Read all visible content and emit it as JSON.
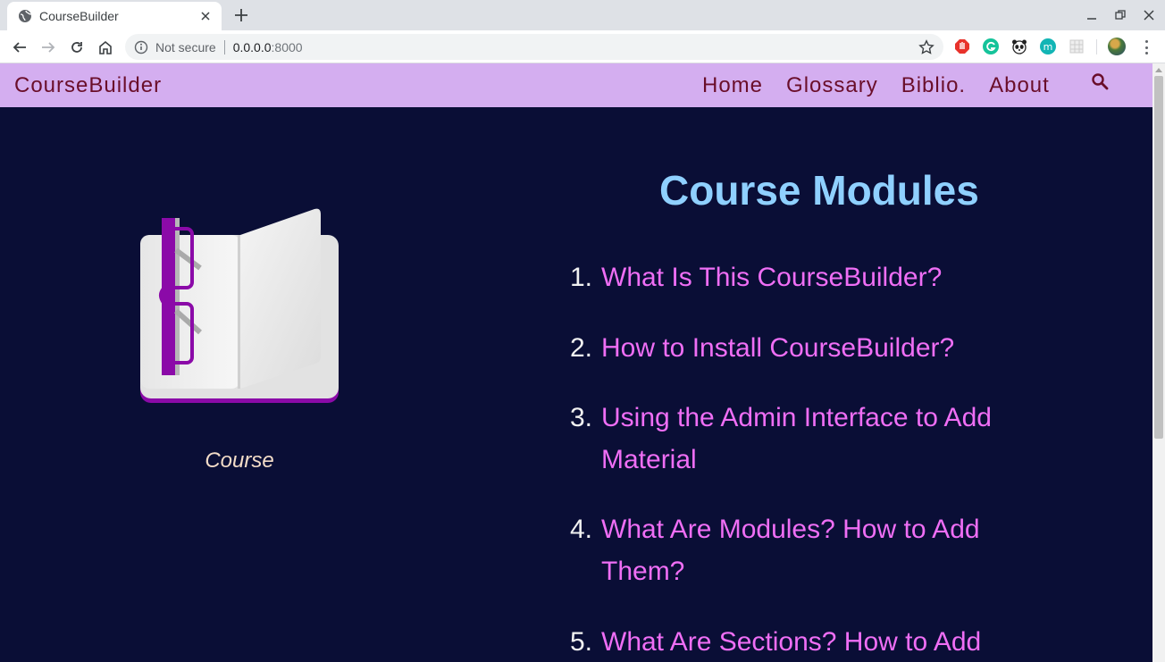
{
  "browser": {
    "tab_title": "CourseBuilder",
    "security_label": "Not secure",
    "url_host": "0.0.0.0",
    "url_port": ":8000"
  },
  "extensions": [
    {
      "name": "adblock-icon",
      "color": "#e8322b"
    },
    {
      "name": "grammarly-icon",
      "color": "#15c39a"
    },
    {
      "name": "panda-icon",
      "color": "#222222"
    },
    {
      "name": "m-extension-icon",
      "color": "#12b5b5"
    },
    {
      "name": "grid-extension-icon",
      "color": "#dadce0"
    }
  ],
  "site": {
    "brand": "CourseBuilder",
    "nav": [
      "Home",
      "Glossary",
      "Biblio.",
      "About"
    ],
    "colors": {
      "nav_bg": "#d4aef0",
      "nav_text": "#6a0e2a",
      "page_bg": "#0a0e36",
      "heading": "#8fd0ff",
      "link": "#ef6ef5"
    }
  },
  "hero": {
    "caption": "Course",
    "image_icon": "open-book-with-glasses-icon"
  },
  "modules": {
    "title": "Course Modules",
    "items": [
      {
        "num": "1.",
        "lines": [
          "What Is This CourseBuilder?"
        ]
      },
      {
        "num": "2.",
        "lines": [
          "How to Install CourseBuilder?"
        ]
      },
      {
        "num": "3.",
        "lines": [
          "Using the Admin Interface to Add",
          "Material"
        ]
      },
      {
        "num": "4.",
        "lines": [
          "What Are Modules? How to Add",
          "Them?"
        ]
      },
      {
        "num": "5.",
        "lines": [
          "What Are Sections? How to Add"
        ]
      }
    ]
  }
}
